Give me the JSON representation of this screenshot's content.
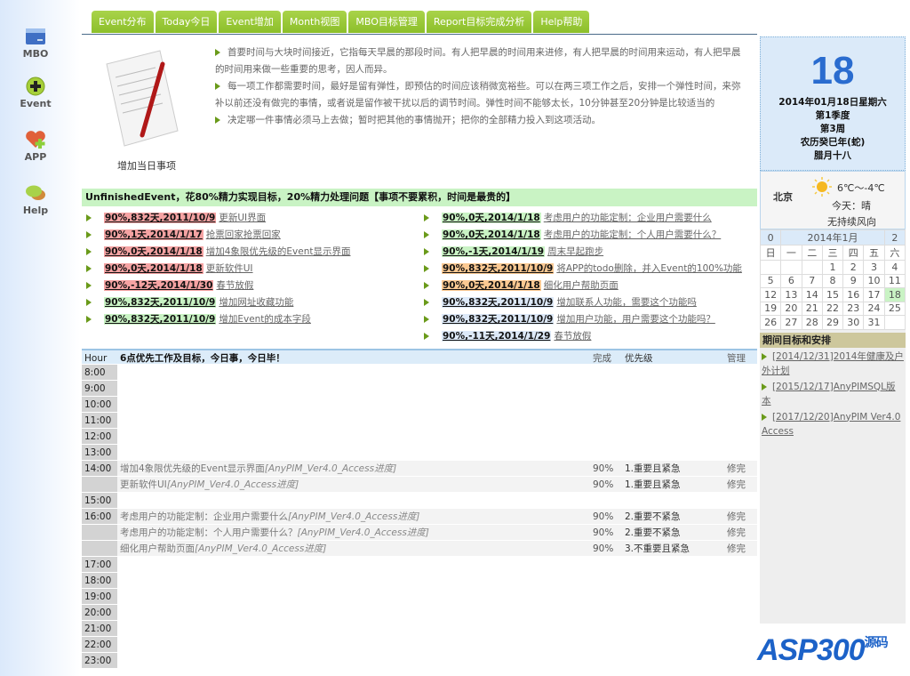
{
  "sidebar": {
    "items": [
      {
        "label": "MBO",
        "icon": "mbo-icon"
      },
      {
        "label": "Event",
        "icon": "add-icon"
      },
      {
        "label": "APP",
        "icon": "heart-plus-icon"
      },
      {
        "label": "Help",
        "icon": "chat-icon"
      }
    ]
  },
  "tabs": [
    "Event分布",
    "Today今日",
    "Event增加",
    "Month视图",
    "MBO目标管理",
    "Report目标完成分析",
    "Help帮助"
  ],
  "intro": {
    "caption": "增加当日事项",
    "tips": [
      "首要时间与大块时间接近，它指每天早晨的那段时间。有人把早晨的时间用来进修，有人把早晨的时间用来运动，有人把早晨的时间用来做一些重要的思考，因人而异。",
      "每一项工作都需要时间，最好是留有弹性，即预估的时间应该稍微宽裕些。可以在两三项工作之后，安排一个弹性时间，来弥补以前还没有做完的事情，或者说是留作被干扰以后的调节时间。弹性时间不能够太长，10分钟甚至20分钟是比较适当的",
      "决定哪一件事情必须马上去做；暂时把其他的事情抛开；把你的全部精力投入到这项活动。"
    ]
  },
  "unfinished": {
    "title": "UnfinishedEvent，花80%精力实现目标，20%精力处理问题【事项不要累积，时间是最贵的】",
    "left": [
      {
        "badge": "90%,832天,2011/10/9",
        "text": "更新UI界面",
        "color": "#f5a3a3"
      },
      {
        "badge": "90%,1天,2014/1/17",
        "text": "抢票回家抢票回家",
        "color": "#f5a3a3"
      },
      {
        "badge": "90%,0天,2014/1/18",
        "text": "增加4象限优先级的Event显示界面",
        "color": "#f5a3a3"
      },
      {
        "badge": "90%,0天,2014/1/18",
        "text": "更新软件UI",
        "color": "#f5a3a3"
      },
      {
        "badge": "90%,-12天,2014/1/30",
        "text": "春节放假",
        "color": "#f5a3a3"
      },
      {
        "badge": "90%,832天,2011/10/9",
        "text": "增加网址收藏功能",
        "color": "#c9f3c4"
      },
      {
        "badge": "90%,832天,2011/10/9",
        "text": "增加Event的成本字段",
        "color": "#c9f3c4"
      }
    ],
    "right": [
      {
        "badge": "90%,0天,2014/1/18",
        "text": "考虑用户的功能定制：企业用户需要什么",
        "color": "#c9f3c4"
      },
      {
        "badge": "90%,0天,2014/1/18",
        "text": "考虑用户的功能定制：个人用户需要什么？",
        "color": "#c9f3c4"
      },
      {
        "badge": "90%,-1天,2014/1/19",
        "text": "周末早起跑步",
        "color": "#c9f3c4"
      },
      {
        "badge": "90%,832天,2011/10/9",
        "text": "将APP的todo删除，并入Event的100%功能",
        "color": "#fbc992"
      },
      {
        "badge": "90%,0天,2014/1/18",
        "text": "细化用户帮助页面",
        "color": "#fbc992"
      },
      {
        "badge": "90%,832天,2011/10/9",
        "text": "增加联系人功能，需要这个功能吗",
        "color": "#dde9f8"
      },
      {
        "badge": "90%,832天,2011/10/9",
        "text": "增加用户功能，用户需要这个功能吗？",
        "color": "#dde9f8"
      },
      {
        "badge": "90%,-11天,2014/1/29",
        "text": "春节放假",
        "color": "#dde9f8"
      }
    ]
  },
  "schedule": {
    "headers": {
      "hour": "Hour",
      "title": "6点优先工作及目标，今日事，今日毕！",
      "done": "完成",
      "priority": "优先级",
      "manage": "管理"
    },
    "rows": [
      {
        "hour": "8:00"
      },
      {
        "hour": "9:00"
      },
      {
        "hour": "10:00"
      },
      {
        "hour": "11:00"
      },
      {
        "hour": "12:00"
      },
      {
        "hour": "13:00"
      },
      {
        "hour": "14:00",
        "text": "增加4象限优先级的Event显示界面",
        "project": "[AnyPIM_Ver4.0_Access进度]",
        "done": "90%",
        "priority": "1.重要且紧急",
        "manage": "修完"
      },
      {
        "hour": "",
        "text": "更新软件UI",
        "project": "[AnyPIM_Ver4.0_Access进度]",
        "done": "90%",
        "priority": "1.重要且紧急",
        "manage": "修完"
      },
      {
        "hour": "15:00"
      },
      {
        "hour": "16:00",
        "text": "考虑用户的功能定制：企业用户需要什么",
        "project": "[AnyPIM_Ver4.0_Access进度]",
        "done": "90%",
        "priority": "2.重要不紧急",
        "manage": "修完"
      },
      {
        "hour": "",
        "text": "考虑用户的功能定制：个人用户需要什么？",
        "project": "[AnyPIM_Ver4.0_Access进度]",
        "done": "90%",
        "priority": "2.重要不紧急",
        "manage": "修完"
      },
      {
        "hour": "",
        "text": "细化用户帮助页面",
        "project": "[AnyPIM_Ver4.0_Access进度]",
        "done": "90%",
        "priority": "3.不重要且紧急",
        "manage": "修完"
      },
      {
        "hour": "17:00"
      },
      {
        "hour": "18:00"
      },
      {
        "hour": "19:00"
      },
      {
        "hour": "20:00"
      },
      {
        "hour": "21:00"
      },
      {
        "hour": "22:00"
      },
      {
        "hour": "23:00"
      }
    ]
  },
  "date": {
    "day": "18",
    "full": "2014年01月18日星期六",
    "quarter": "第1季度",
    "week": "第3周",
    "lunar_year": "农历癸巳年(蛇)",
    "lunar_day": "腊月十八"
  },
  "weather": {
    "city": "北京",
    "temp": "6℃～-4℃",
    "today": "今天：晴",
    "wind": "无持续风向"
  },
  "calendar": {
    "prev": "0",
    "title": "2014年1月",
    "next": "2",
    "weekdays": [
      "日",
      "一",
      "二",
      "三",
      "四",
      "五",
      "六"
    ],
    "weeks": [
      [
        "",
        "",
        "",
        "1",
        "2",
        "3",
        "4"
      ],
      [
        "5",
        "6",
        "7",
        "8",
        "9",
        "10",
        "11"
      ],
      [
        "12",
        "13",
        "14",
        "15",
        "16",
        "17",
        "18"
      ],
      [
        "19",
        "20",
        "21",
        "22",
        "23",
        "24",
        "25"
      ],
      [
        "26",
        "27",
        "28",
        "29",
        "30",
        "31",
        ""
      ]
    ],
    "today": "18"
  },
  "goals": {
    "title": "期间目标和安排",
    "items": [
      "[2014/12/31]2014年健康及户外计划",
      "[2015/12/17]AnyPIMSQL版本",
      "[2017/12/20]AnyPIM Ver4.0 Access"
    ]
  },
  "logo": {
    "text": "ASP300",
    "sub": "源码"
  }
}
